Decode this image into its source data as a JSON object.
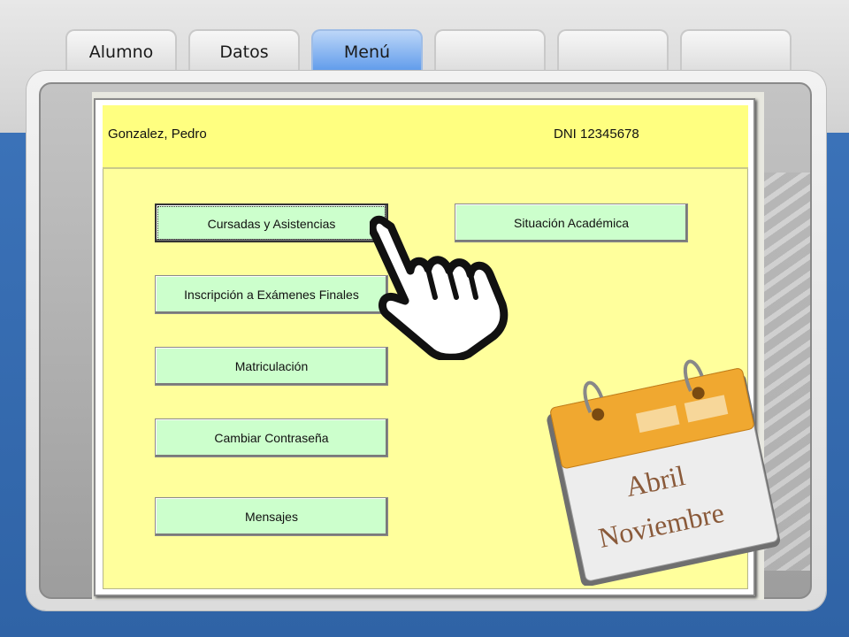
{
  "tabs": [
    {
      "label": "Alumno",
      "active": false
    },
    {
      "label": "Datos",
      "active": false
    },
    {
      "label": "Menú",
      "active": true
    },
    {
      "label": "",
      "active": false
    },
    {
      "label": "",
      "active": false
    },
    {
      "label": "",
      "active": false
    }
  ],
  "student": {
    "name": "Gonzalez, Pedro",
    "dni": "DNI 12345678"
  },
  "menu": {
    "cursadas": "Cursadas y Asistencias",
    "situacion": "Situación Académica",
    "inscripcion": "Inscripción a Exámenes Finales",
    "matriculacion": "Matriculación",
    "contrasena": "Cambiar Contraseña",
    "mensajes": "Mensajes"
  },
  "calendar": {
    "line1": "Abril",
    "line2": "Noviembre"
  },
  "colors": {
    "accent_tab": "#5a98ea",
    "panel": "#ffff9c",
    "button": "#ccffcc",
    "calendar_header": "#f0a830"
  },
  "icons": [
    "pointing-hand-icon",
    "calendar-icon"
  ]
}
